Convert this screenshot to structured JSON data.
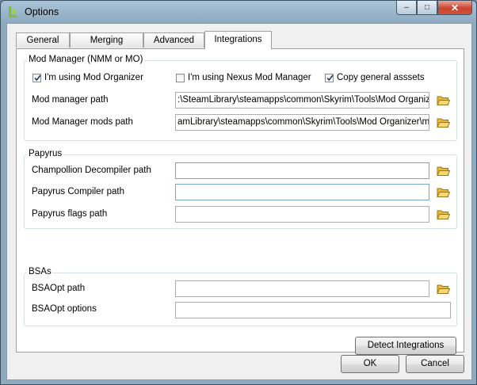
{
  "window": {
    "title": "Options"
  },
  "tabs": [
    {
      "label": "General"
    },
    {
      "label": "Merging"
    },
    {
      "label": "Advanced"
    },
    {
      "label": "Integrations"
    }
  ],
  "mod_manager": {
    "group_label": "Mod Manager (NMM or MO)",
    "using_mo": {
      "label": "I'm using Mod Organizer",
      "checked": true
    },
    "using_nmm": {
      "label": "I'm using Nexus Mod Manager",
      "checked": false
    },
    "copy_assets": {
      "label": "Copy general asssets",
      "checked": true
    },
    "path_label": "Mod manager path",
    "path_value": ":\\SteamLibrary\\steamapps\\common\\Skyrim\\Tools\\Mod Organizer\\",
    "mods_path_label": "Mod Manager mods path",
    "mods_path_value": "amLibrary\\steamapps\\common\\Skyrim\\Tools\\Mod Organizer\\mods\\"
  },
  "papyrus": {
    "group_label": "Papyrus",
    "decompiler_label": "Champollion Decompiler path",
    "decompiler_value": "",
    "compiler_label": "Papyrus Compiler path",
    "compiler_value": "",
    "flags_label": "Papyrus flags path",
    "flags_value": ""
  },
  "bsas": {
    "group_label": "BSAs",
    "bsaopt_path_label": "BSAOpt path",
    "bsaopt_path_value": "",
    "bsaopt_options_label": "BSAOpt options",
    "bsaopt_options_value": ""
  },
  "buttons": {
    "detect": "Detect Integrations",
    "ok": "OK",
    "cancel": "Cancel"
  },
  "caption": {
    "minimize": "–",
    "maximize": "□",
    "close": "✕"
  }
}
